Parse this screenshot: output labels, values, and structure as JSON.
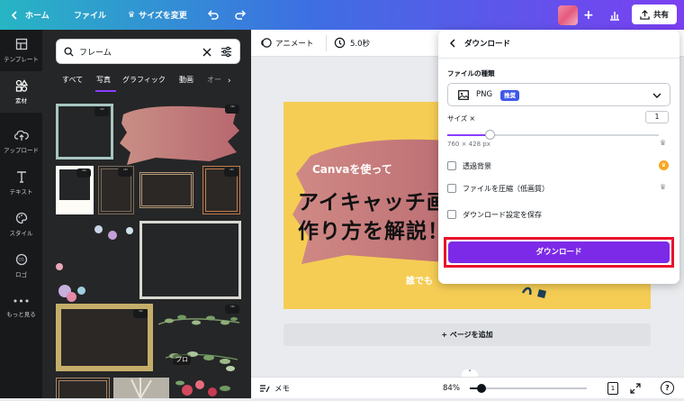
{
  "topbar": {
    "home": "ホーム",
    "file": "ファイル",
    "resize": "サイズを変更",
    "share": "共有"
  },
  "rail": {
    "items": [
      {
        "label": "テンプレート"
      },
      {
        "label": "素材"
      },
      {
        "label": "アップロード"
      },
      {
        "label": "テキスト"
      },
      {
        "label": "スタイル"
      },
      {
        "label": "ロゴ"
      },
      {
        "label": "もっと見る"
      }
    ]
  },
  "panel": {
    "search_value": "フレーム",
    "tabs": [
      "すべて",
      "写真",
      "グラフィック",
      "動画",
      "オー"
    ],
    "pro_badge": "プロ"
  },
  "toolbar": {
    "animate": "アニメート",
    "duration": "5.0秒"
  },
  "design": {
    "small": "Canvaを使って",
    "line1": "アイキャッチ画",
    "line2": "作り方を解説！",
    "partial": "誰でも"
  },
  "canvas": {
    "add_page": "+ ページを追加"
  },
  "bottombar": {
    "notes": "メモ",
    "zoom": "84%",
    "page_num": "1",
    "zoom_level": 0.1
  },
  "download_panel": {
    "title": "ダウンロード",
    "file_type_label": "ファイルの種類",
    "file_type": "PNG",
    "recommended": "推奨",
    "size_label": "サイズ ×",
    "size_value": "1",
    "size_level": 0.2,
    "dimensions": "760 × 428 px",
    "transparent_bg": "透過背景",
    "compress": "ファイルを圧縮（低画質）",
    "save_settings": "ダウンロード設定を保存",
    "download_button": "ダウンロード"
  },
  "colors": {
    "accent": "#7d2ae8",
    "highlight_border": "#e8132b",
    "design_bg": "#f5cd54",
    "crown": "#f5a623"
  }
}
